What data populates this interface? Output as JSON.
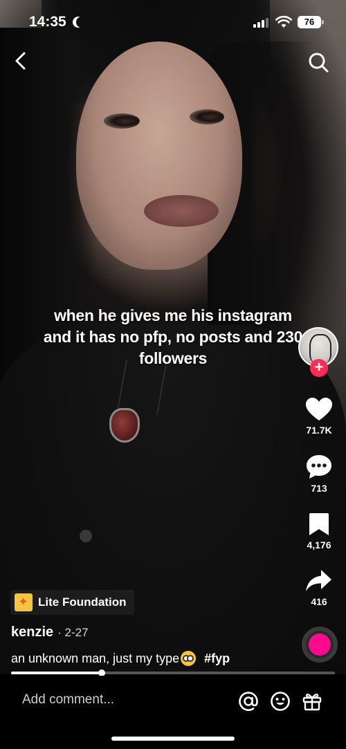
{
  "status_bar": {
    "time": "14:35",
    "battery": "76"
  },
  "video": {
    "caption": "when he gives me his instagram and it has no pfp, no posts and 230 followers"
  },
  "actions": {
    "likes": "71.7K",
    "comments": "713",
    "saves": "4,176",
    "shares": "416"
  },
  "post": {
    "sponsor": "Lite Foundation",
    "author": "kenzie",
    "date": "2-27",
    "description": "an unknown man, just my type",
    "hashtag": "#fyp",
    "progress": 0.28
  },
  "comment_bar": {
    "placeholder": "Add comment..."
  },
  "colors": {
    "follow_badge": "#fe2c55",
    "music_disc": "#ff0a8c"
  }
}
